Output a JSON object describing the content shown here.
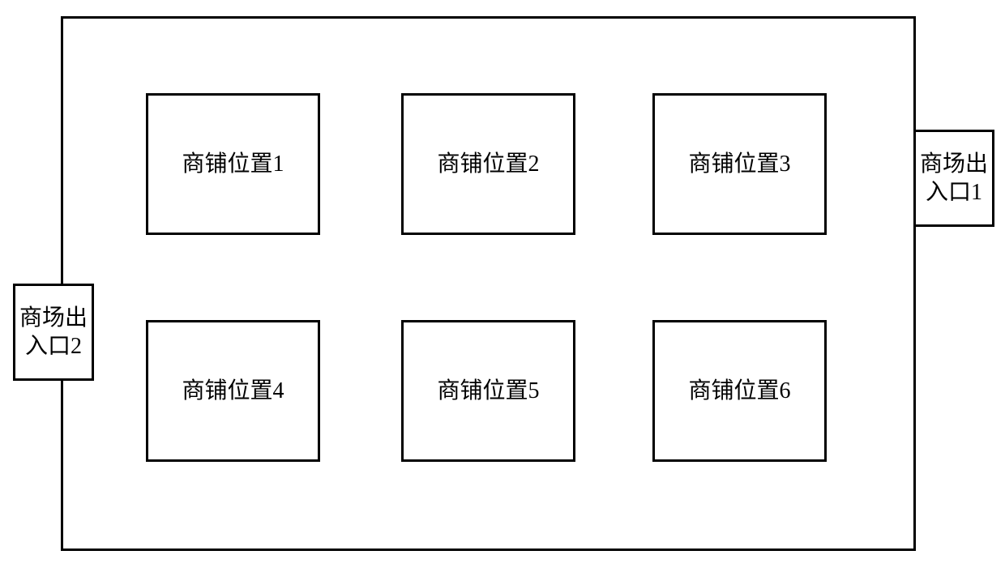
{
  "shops": {
    "s1": "商铺位置1",
    "s2": "商铺位置2",
    "s3": "商铺位置3",
    "s4": "商铺位置4",
    "s5": "商铺位置5",
    "s6": "商铺位置6"
  },
  "entrances": {
    "e1": "商场出入口1",
    "e2": "商场出入口2"
  }
}
